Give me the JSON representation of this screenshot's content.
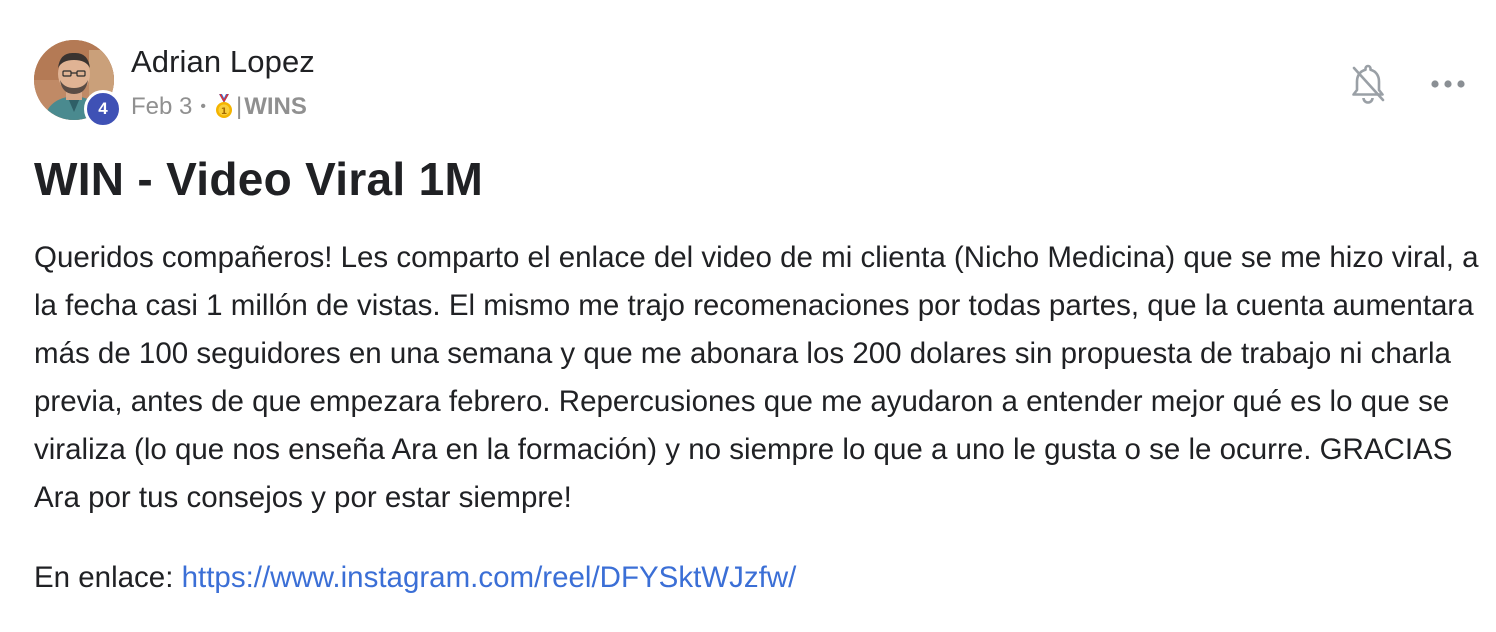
{
  "post": {
    "author": {
      "name": "Adrian Lopez",
      "level": "4"
    },
    "meta": {
      "date": "Feb 3",
      "separator": "•",
      "category_prefix": "| ",
      "category": "WINS"
    },
    "icons": {
      "avatar": "user-avatar-photo",
      "medal": "gold-medal-icon",
      "notifications": "bell-off-icon",
      "more": "more-options-icon"
    },
    "title": "WIN - Video Viral 1M",
    "body": "Queridos compañeros! Les comparto el enlace del video de mi clienta (Nicho Medicina) que se me hizo viral, a la fecha casi 1 millón de vistas. El mismo me trajo recomenaciones por todas partes, que la cuenta aumentara más de 100 seguidores en una semana y que me abonara los 200 dolares sin propuesta de trabajo ni charla previa, antes de que empezara febrero. Repercusiones que me ayudaron a entender mejor qué es lo que se viraliza (lo que nos enseña Ara en la formación) y no siempre lo que a uno le gusta o se le ocurre. GRACIAS Ara por tus consejos y por estar siempre!",
    "link_label": "En enlace: ",
    "link_url": "https://www.instagram.com/reel/DFYSktWJzfw/"
  },
  "colors": {
    "text": "#202124",
    "meta": "#909090",
    "link": "#3b6fd6",
    "level_badge": "#3f51b5"
  }
}
